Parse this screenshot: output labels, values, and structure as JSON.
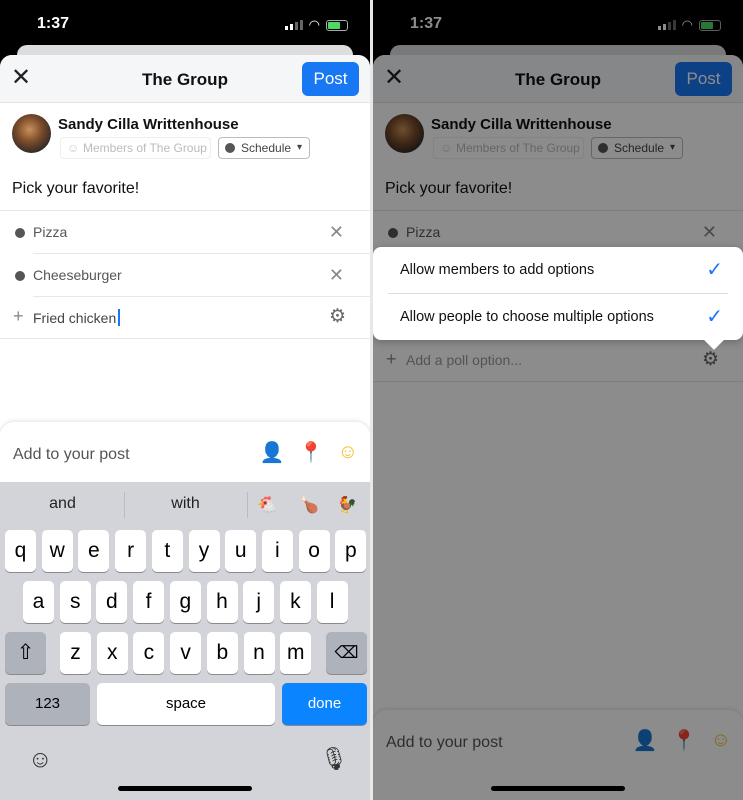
{
  "status": {
    "time": "1:37"
  },
  "header": {
    "title": "The Group",
    "post_label": "Post",
    "close_icon": "close-icon"
  },
  "author": {
    "name": "Sandy Cilla Writtenhouse",
    "audience": "Members of The Group",
    "schedule": "Schedule"
  },
  "poll": {
    "question": "Pick your favorite!",
    "options": [
      "Pizza",
      "Cheeseburger"
    ],
    "input_value": "Fried chicken",
    "input_placeholder": "Add a poll option..."
  },
  "add_to_post": {
    "label": "Add to your post",
    "icons": [
      "tag-people-icon",
      "location-pin-icon",
      "feeling-emoji-icon"
    ]
  },
  "keyboard": {
    "suggestions": [
      "and",
      "with",
      "🐔",
      "🍗",
      "🐓"
    ],
    "rows": [
      [
        "q",
        "w",
        "e",
        "r",
        "t",
        "y",
        "u",
        "i",
        "o",
        "p"
      ],
      [
        "a",
        "s",
        "d",
        "f",
        "g",
        "h",
        "j",
        "k",
        "l"
      ],
      [
        "z",
        "x",
        "c",
        "v",
        "b",
        "n",
        "m"
      ]
    ],
    "numbers": "123",
    "space": "space",
    "done": "done"
  },
  "settings_menu": {
    "items": [
      {
        "label": "Allow members to add options",
        "checked": true
      },
      {
        "label": "Allow people to choose multiple options",
        "checked": true
      }
    ]
  },
  "colors": {
    "accent": "#1877f2",
    "keyboard_bg": "#d2d4da"
  }
}
